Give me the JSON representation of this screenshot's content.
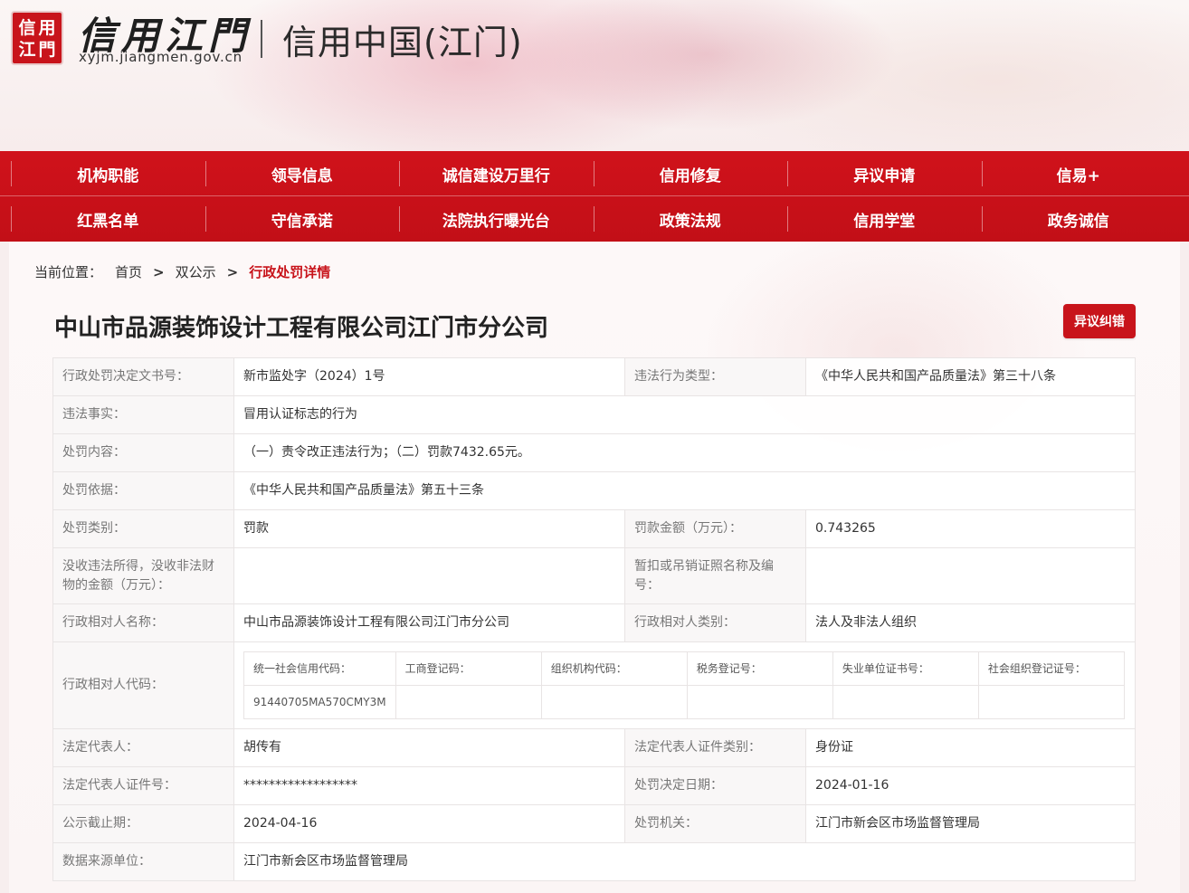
{
  "header": {
    "seal_chars": [
      "信",
      "用",
      "江",
      "門"
    ],
    "logo_text": "信用江門",
    "url": "xyjm.jiangmen.gov.cn",
    "title": "信用中国(江门)"
  },
  "nav": {
    "row1": [
      "机构职能",
      "领导信息",
      "诚信建设万里行",
      "信用修复",
      "异议申请",
      "信易+"
    ],
    "row2": [
      "红黑名单",
      "守信承诺",
      "法院执行曝光台",
      "政策法规",
      "信用学堂",
      "政务诚信"
    ]
  },
  "breadcrumb": {
    "label": "当前位置：",
    "home": "首页",
    "section": "双公示",
    "current": "行政处罚详情",
    "sep": ">"
  },
  "page": {
    "title": "中山市品源装饰设计工程有限公司江门市分公司",
    "objection_button": "异议纠错"
  },
  "detail": {
    "decision_no_label": "行政处罚决定文书号：",
    "decision_no": "新市监处字（2024）1号",
    "violation_type_label": "违法行为类型：",
    "violation_type": "《中华人民共和国产品质量法》第三十八条",
    "facts_label": "违法事实：",
    "facts": "冒用认证标志的行为",
    "content_label": "处罚内容：",
    "content": "（一）责令改正违法行为；（二）罚款7432.65元。",
    "basis_label": "处罚依据：",
    "basis": "《中华人民共和国产品质量法》第五十三条",
    "category_label": "处罚类别：",
    "category": "罚款",
    "amount_label": "罚款金额（万元）：",
    "amount": "0.743265",
    "confiscated_label": "没收违法所得，没收非法财物的金额（万元）：",
    "confiscated": "",
    "license_label": "暂扣或吊销证照名称及编号：",
    "license": "",
    "party_name_label": "行政相对人名称：",
    "party_name": "中山市品源装饰设计工程有限公司江门市分公司",
    "party_type_label": "行政相对人类别：",
    "party_type": "法人及非法人组织",
    "party_code_label": "行政相对人代码：",
    "codes": {
      "headers": [
        "统一社会信用代码：",
        "工商登记码：",
        "组织机构代码：",
        "税务登记号：",
        "失业单位证书号：",
        "社会组织登记证号："
      ],
      "values": [
        "91440705MA570CMY3M",
        "",
        "",
        "",
        "",
        ""
      ]
    },
    "legal_rep_label": "法定代表人：",
    "legal_rep": "胡传有",
    "legal_rep_id_type_label": "法定代表人证件类别：",
    "legal_rep_id_type": "身份证",
    "legal_rep_id_no_label": "法定代表人证件号：",
    "legal_rep_id_no": "******************",
    "decision_date_label": "处罚决定日期：",
    "decision_date": "2024-01-16",
    "publicity_end_label": "公示截止期：",
    "publicity_end": "2024-04-16",
    "authority_label": "处罚机关：",
    "authority": "江门市新会区市场监督管理局",
    "data_source_label": "数据来源单位：",
    "data_source": "江门市新会区市场监督管理局"
  }
}
